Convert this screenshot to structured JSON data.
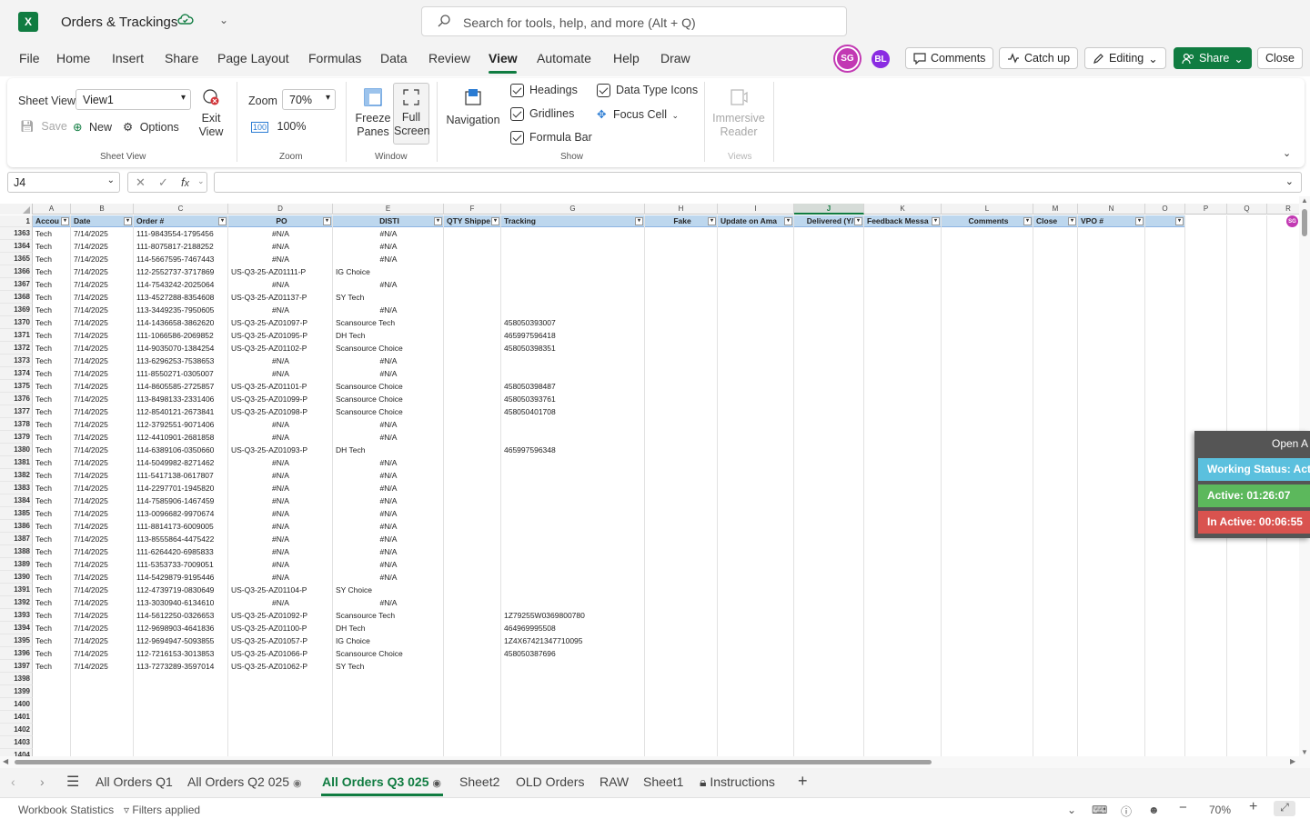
{
  "app": {
    "title": "Orders & Trackings",
    "logo": "X",
    "search_placeholder": "Search for tools, help, and more (Alt + Q)"
  },
  "menu": [
    "File",
    "Home",
    "Insert",
    "Share",
    "Page Layout",
    "Formulas",
    "Data",
    "Review",
    "View",
    "Automate",
    "Help",
    "Draw"
  ],
  "avatars": [
    {
      "initials": "SG",
      "color": "#c239b3"
    },
    {
      "initials": "BL",
      "color": "#8a2be2"
    }
  ],
  "toolbar": {
    "comments": "Comments",
    "catchup": "Catch up",
    "editing": "Editing",
    "share": "Share",
    "close": "Close"
  },
  "ribbon": {
    "sheet_view_label": "Sheet View",
    "sheet_view_value": "View1",
    "save": "Save",
    "new": "New",
    "options": "Options",
    "exit_view": "Exit View",
    "group_sheet_view": "Sheet View",
    "zoom_label": "Zoom",
    "zoom_value": "70%",
    "zoom_100": "100%",
    "group_zoom": "Zoom",
    "freeze_panes": "Freeze Panes",
    "full_screen": "Full Screen",
    "group_window": "Window",
    "navigation": "Navigation",
    "headings": "Headings",
    "gridlines": "Gridlines",
    "formula_bar": "Formula Bar",
    "data_type_icons": "Data Type Icons",
    "focus_cell": "Focus Cell",
    "group_show": "Show",
    "immersive_reader": "Immersive Reader",
    "group_views": "Views"
  },
  "formula_bar": {
    "name_box": "J4",
    "formula": ""
  },
  "columns": [
    "A",
    "B",
    "C",
    "D",
    "E",
    "F",
    "G",
    "H",
    "I",
    "J",
    "K",
    "L",
    "M",
    "N",
    "O",
    "P",
    "Q",
    "R"
  ],
  "headers": [
    "Accou",
    "Date",
    "Order #",
    "PO",
    "DISTI",
    "QTY Shippe",
    "Tracking",
    "Fake",
    "Update on Ama",
    "Delivered (Y/",
    "Feedback Messa",
    "Comments",
    "Close",
    "VPO #",
    ""
  ],
  "rows": [
    {
      "n": "1363",
      "a": "Tech",
      "b": "7/14/2025",
      "c": "111-9843554-1795456",
      "d": "#N/A",
      "e": "#N/A",
      "g": ""
    },
    {
      "n": "1364",
      "a": "Tech",
      "b": "7/14/2025",
      "c": "111-8075817-2188252",
      "d": "#N/A",
      "e": "#N/A",
      "g": ""
    },
    {
      "n": "1365",
      "a": "Tech",
      "b": "7/14/2025",
      "c": "114-5667595-7467443",
      "d": "#N/A",
      "e": "#N/A",
      "g": ""
    },
    {
      "n": "1366",
      "a": "Tech",
      "b": "7/14/2025",
      "c": "112-2552737-3717869",
      "d": "US-Q3-25-AZ01111-P",
      "e": "IG Choice",
      "g": ""
    },
    {
      "n": "1367",
      "a": "Tech",
      "b": "7/14/2025",
      "c": "114-7543242-2025064",
      "d": "#N/A",
      "e": "#N/A",
      "g": ""
    },
    {
      "n": "1368",
      "a": "Tech",
      "b": "7/14/2025",
      "c": "113-4527288-8354608",
      "d": "US-Q3-25-AZ01137-P",
      "e": "SY Tech",
      "g": ""
    },
    {
      "n": "1369",
      "a": "Tech",
      "b": "7/14/2025",
      "c": "113-3449235-7950605",
      "d": "#N/A",
      "e": "#N/A",
      "g": ""
    },
    {
      "n": "1370",
      "a": "Tech",
      "b": "7/14/2025",
      "c": "114-1436658-3862620",
      "d": "US-Q3-25-AZ01097-P",
      "e": "Scansource Tech",
      "g": "458050393007"
    },
    {
      "n": "1371",
      "a": "Tech",
      "b": "7/14/2025",
      "c": "111-1066586-2069852",
      "d": "US-Q3-25-AZ01095-P",
      "e": "DH Tech",
      "g": "465997596418"
    },
    {
      "n": "1372",
      "a": "Tech",
      "b": "7/14/2025",
      "c": "114-9035070-1384254",
      "d": "US-Q3-25-AZ01102-P",
      "e": "Scansource Choice",
      "g": "458050398351"
    },
    {
      "n": "1373",
      "a": "Tech",
      "b": "7/14/2025",
      "c": "113-6296253-7538653",
      "d": "#N/A",
      "e": "#N/A",
      "g": ""
    },
    {
      "n": "1374",
      "a": "Tech",
      "b": "7/14/2025",
      "c": "111-8550271-0305007",
      "d": "#N/A",
      "e": "#N/A",
      "g": ""
    },
    {
      "n": "1375",
      "a": "Tech",
      "b": "7/14/2025",
      "c": "114-8605585-2725857",
      "d": "US-Q3-25-AZ01101-P",
      "e": "Scansource Choice",
      "g": "458050398487"
    },
    {
      "n": "1376",
      "a": "Tech",
      "b": "7/14/2025",
      "c": "113-8498133-2331406",
      "d": "US-Q3-25-AZ01099-P",
      "e": "Scansource Choice",
      "g": "458050393761"
    },
    {
      "n": "1377",
      "a": "Tech",
      "b": "7/14/2025",
      "c": "112-8540121-2673841",
      "d": "US-Q3-25-AZ01098-P",
      "e": "Scansource Choice",
      "g": "458050401708"
    },
    {
      "n": "1378",
      "a": "Tech",
      "b": "7/14/2025",
      "c": "112-3792551-9071406",
      "d": "#N/A",
      "e": "#N/A",
      "g": ""
    },
    {
      "n": "1379",
      "a": "Tech",
      "b": "7/14/2025",
      "c": "112-4410901-2681858",
      "d": "#N/A",
      "e": "#N/A",
      "g": ""
    },
    {
      "n": "1380",
      "a": "Tech",
      "b": "7/14/2025",
      "c": "114-6389106-0350660",
      "d": "US-Q3-25-AZ01093-P",
      "e": "DH Tech",
      "g": "465997596348"
    },
    {
      "n": "1381",
      "a": "Tech",
      "b": "7/14/2025",
      "c": "114-5049982-8271462",
      "d": "#N/A",
      "e": "#N/A",
      "g": ""
    },
    {
      "n": "1382",
      "a": "Tech",
      "b": "7/14/2025",
      "c": "111-5417138-0617807",
      "d": "#N/A",
      "e": "#N/A",
      "g": ""
    },
    {
      "n": "1383",
      "a": "Tech",
      "b": "7/14/2025",
      "c": "114-2297701-1945820",
      "d": "#N/A",
      "e": "#N/A",
      "g": ""
    },
    {
      "n": "1384",
      "a": "Tech",
      "b": "7/14/2025",
      "c": "114-7585906-1467459",
      "d": "#N/A",
      "e": "#N/A",
      "g": ""
    },
    {
      "n": "1385",
      "a": "Tech",
      "b": "7/14/2025",
      "c": "113-0096682-9970674",
      "d": "#N/A",
      "e": "#N/A",
      "g": ""
    },
    {
      "n": "1386",
      "a": "Tech",
      "b": "7/14/2025",
      "c": "111-8814173-6009005",
      "d": "#N/A",
      "e": "#N/A",
      "g": ""
    },
    {
      "n": "1387",
      "a": "Tech",
      "b": "7/14/2025",
      "c": "113-8555864-4475422",
      "d": "#N/A",
      "e": "#N/A",
      "g": ""
    },
    {
      "n": "1388",
      "a": "Tech",
      "b": "7/14/2025",
      "c": "111-6264420-6985833",
      "d": "#N/A",
      "e": "#N/A",
      "g": ""
    },
    {
      "n": "1389",
      "a": "Tech",
      "b": "7/14/2025",
      "c": "111-5353733-7009051",
      "d": "#N/A",
      "e": "#N/A",
      "g": ""
    },
    {
      "n": "1390",
      "a": "Tech",
      "b": "7/14/2025",
      "c": "114-5429879-9195446",
      "d": "#N/A",
      "e": "#N/A",
      "g": ""
    },
    {
      "n": "1391",
      "a": "Tech",
      "b": "7/14/2025",
      "c": "112-4739719-0830649",
      "d": "US-Q3-25-AZ01104-P",
      "e": "SY Choice",
      "g": ""
    },
    {
      "n": "1392",
      "a": "Tech",
      "b": "7/14/2025",
      "c": "113-3030940-6134610",
      "d": "#N/A",
      "e": "#N/A",
      "g": ""
    },
    {
      "n": "1393",
      "a": "Tech",
      "b": "7/14/2025",
      "c": "114-5612250-0326653",
      "d": "US-Q3-25-AZ01092-P",
      "e": "Scansource Tech",
      "g": "1Z79255W0369800780"
    },
    {
      "n": "1394",
      "a": "Tech",
      "b": "7/14/2025",
      "c": "112-9698903-4641836",
      "d": "US-Q3-25-AZ01100-P",
      "e": "DH Tech",
      "g": "464969995508"
    },
    {
      "n": "1395",
      "a": "Tech",
      "b": "7/14/2025",
      "c": "112-9694947-5093855",
      "d": "US-Q3-25-AZ01057-P",
      "e": "IG Choice",
      "g": "1Z4X67421347710095"
    },
    {
      "n": "1396",
      "a": "Tech",
      "b": "7/14/2025",
      "c": "112-7216153-3013853",
      "d": "US-Q3-25-AZ01066-P",
      "e": "Scansource Choice",
      "g": "458050387696"
    },
    {
      "n": "1397",
      "a": "Tech",
      "b": "7/14/2025",
      "c": "113-7273289-3597014",
      "d": "US-Q3-25-AZ01062-P",
      "e": "SY Tech",
      "g": ""
    }
  ],
  "empty_rows": [
    "1398",
    "1399",
    "1400",
    "1401",
    "1402",
    "1403",
    "1404"
  ],
  "header_row": "1",
  "sheets": [
    "All Orders Q1",
    "All Orders Q2 025",
    "All Orders Q3 025",
    "Sheet2",
    "OLD Orders",
    "RAW",
    "Sheet1",
    "Instructions"
  ],
  "status": {
    "workbook_stats": "Workbook Statistics",
    "filters": "Filters applied",
    "zoom": "70%"
  },
  "tracker": {
    "open": "Open A",
    "working": "Working Status: Acti",
    "active": "Active: 01:26:07",
    "inactive": "In Active: 00:06:55",
    "color_working": "#5bc0de",
    "color_active": "#5cb85c",
    "color_inactive": "#d9534f"
  },
  "colors": {
    "accent": "#107c41",
    "header_fill": "#bdd7ee"
  }
}
